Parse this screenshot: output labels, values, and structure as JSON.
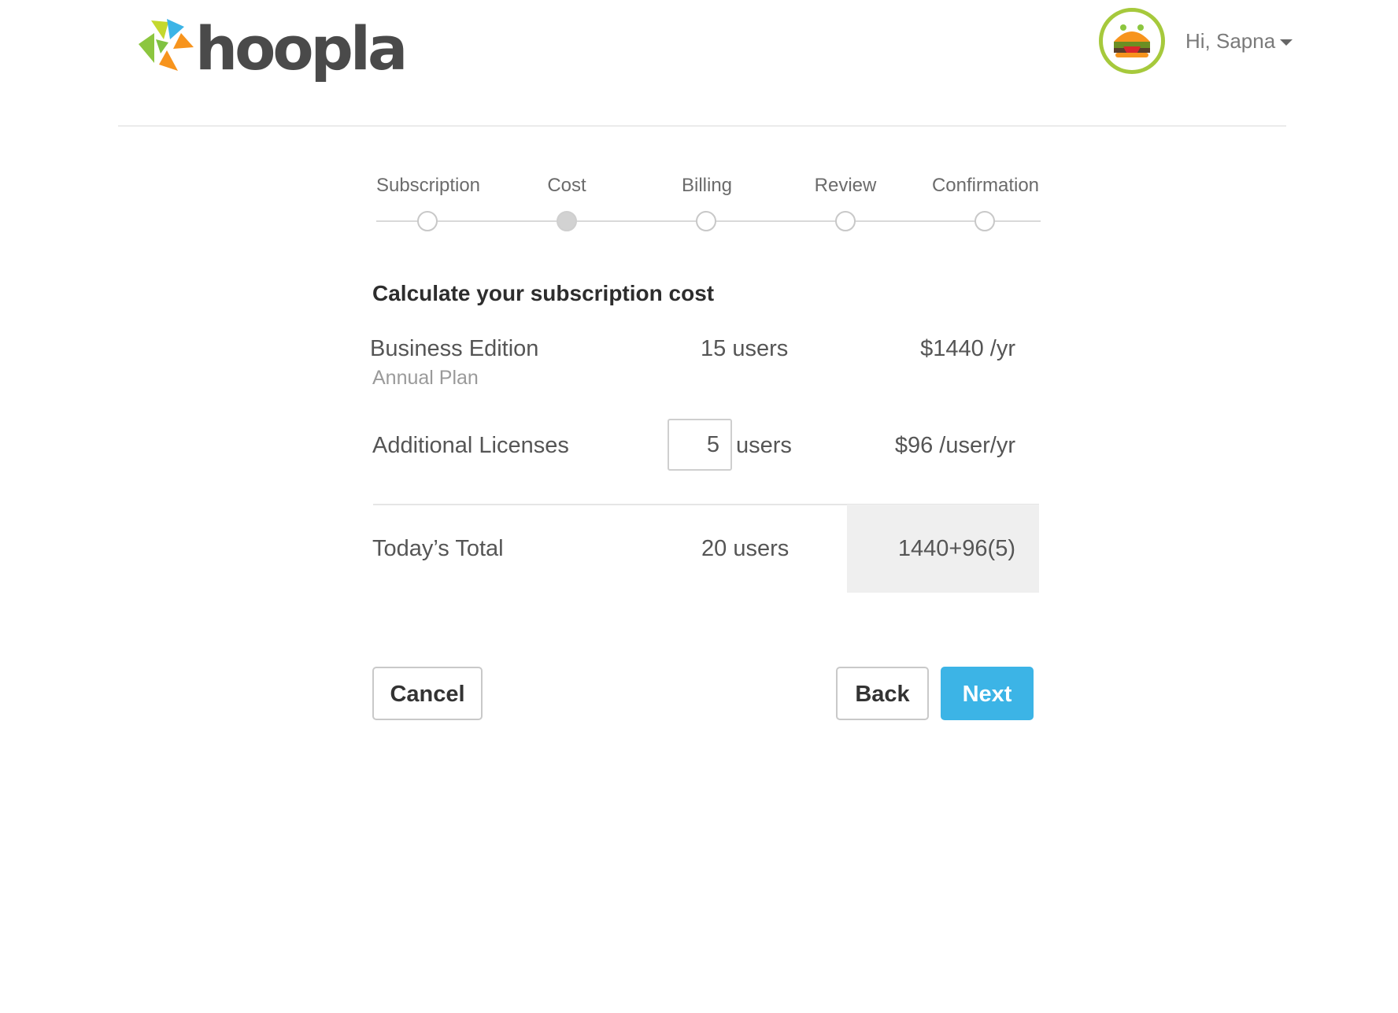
{
  "brand": {
    "name": "hoopla"
  },
  "user": {
    "greeting": "Hi, Sapna"
  },
  "stepper": {
    "steps": [
      {
        "label": "Subscription",
        "active": false
      },
      {
        "label": "Cost",
        "active": true
      },
      {
        "label": "Billing",
        "active": false
      },
      {
        "label": "Review",
        "active": false
      },
      {
        "label": "Confirmation",
        "active": false
      }
    ]
  },
  "page": {
    "heading": "Calculate your subscription cost"
  },
  "cost_table": {
    "edition": {
      "name": "Business Edition",
      "plan": "Annual Plan",
      "users": "15 users",
      "price": "$1440 /yr"
    },
    "additional": {
      "label": "Additional Licenses",
      "quantity": "5",
      "users_label": "users",
      "price": "$96 /user/yr"
    },
    "total": {
      "label": "Today’s Total",
      "users": "20 users",
      "amount": "1440+96(5)"
    }
  },
  "buttons": {
    "cancel": "Cancel",
    "back": "Back",
    "next": "Next"
  },
  "colors": {
    "accent": "#3cb4e6",
    "avatar_ring": "#a6c93c"
  }
}
